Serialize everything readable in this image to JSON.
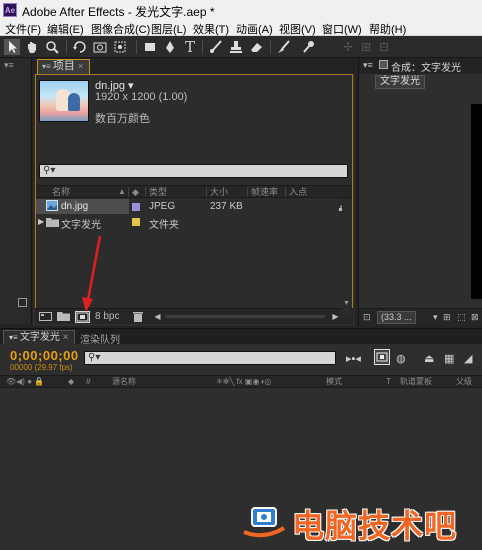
{
  "window": {
    "title": "Adobe After Effects - 发光文字.aep *",
    "app_icon_text": "Ae"
  },
  "menu": [
    "文件(F)",
    "编辑(E)",
    "图像合成(C)",
    "图层(L)",
    "效果(T)",
    "动画(A)",
    "视图(V)",
    "窗口(W)",
    "帮助(H)"
  ],
  "toolbar": {
    "icons": [
      "selection-tool-icon",
      "hand-tool-icon",
      "zoom-tool-icon",
      "rotate-tool-icon",
      "camera-tool-icon",
      "pan-behind-tool-icon",
      "rectangle-tool-icon",
      "pen-tool-icon",
      "type-tool-icon",
      "brush-tool-icon",
      "clone-stamp-tool-icon",
      "eraser-tool-icon",
      "roto-brush-tool-icon",
      "puppet-pin-tool-icon"
    ],
    "type_glyph": "T"
  },
  "project_panel": {
    "tab_label": "项目",
    "item": {
      "name": "dn.jpg ▾",
      "dimensions": "1920 x 1200 (1.00)",
      "colors": "数百万颜色"
    },
    "columns": [
      "名称",
      "类型",
      "大小",
      "帧速率",
      "入点"
    ],
    "rows": [
      {
        "name": "dn.jpg",
        "type": "JPEG",
        "size": "237 KB",
        "label_color": "#9c8fd6"
      },
      {
        "name": "文字发光",
        "type": "文件夹",
        "size": "",
        "label_color": "#e3c54a"
      }
    ],
    "footer_bpc": "8 bpc"
  },
  "comp_panel": {
    "tab_label": "合成：文字发光",
    "comp_button": "文字发光",
    "zoom": "(33.3 ..."
  },
  "timeline": {
    "tabs": [
      "文字发光",
      "渲染队列"
    ],
    "timecode": "0;00;00;00",
    "fps": "00000 (29.97 fps)",
    "columns": [
      "#",
      "源名称",
      "模式",
      "T",
      "轨道蒙板",
      "父级"
    ]
  },
  "watermark": {
    "text": "电脑技术吧"
  },
  "colors": {
    "accent_orange": "#e7a10e",
    "panel_highlight": "#c98c18",
    "arrow_red": "#e02020"
  }
}
